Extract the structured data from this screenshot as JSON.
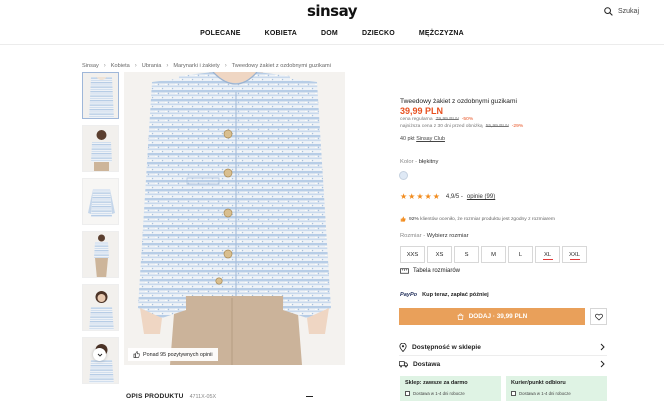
{
  "header": {
    "logo": "sinsay",
    "search_label": "Szukaj",
    "nav": [
      "POLECANE",
      "KOBIETA",
      "DOM",
      "DZIECKO",
      "MĘŻCZYZNA"
    ]
  },
  "breadcrumb": [
    "Sinsay",
    "Kobieta",
    "Ubrania",
    "Marynarki i żakiety",
    "Tweedowy żakiet z ozdobnymi guzikami"
  ],
  "gallery": {
    "reviews_pill": "Ponad 95 pozytywnych opinii"
  },
  "product": {
    "title": "Tweedowy żakiet z ozdobnymi guzikami",
    "price": "39,99 PLN",
    "regular_label": "cena regularna",
    "regular_price": "79,99 PLN",
    "regular_discount": "-50%",
    "lowest_label": "najniższa cena z 30 dni przed obniżką",
    "lowest_price": "55,99 PLN",
    "lowest_discount": "-29%",
    "points_text": "40 pkt",
    "points_link": "Sinsay Club",
    "color_label": "Kolor -",
    "color_value": "błękitny",
    "swatch_color": "#dfe9f5",
    "rating_value": "4,9/5 -",
    "rating_stars": 5,
    "rating_link": "opinie (99)",
    "fit_pct": "92%",
    "fit_text": "klientów oceniło, że rozmiar produktu jest zgodny z rozmiarem",
    "size_label": "Rozmiar -",
    "size_value": "Wybierz rozmiar",
    "sizes": [
      "XXS",
      "XS",
      "S",
      "M",
      "L",
      "XL",
      "XXL"
    ],
    "size_table": "Tabela rozmiarów",
    "paypo_logo": "PayPo",
    "paypo_text": "Kup teraz, zapłać później",
    "add_button": "DODAJ · 39,99 PLN"
  },
  "links": {
    "availability": "Dostępność w sklepie",
    "delivery": "Dostawa"
  },
  "delivery_options": [
    {
      "title": "Sklep: zawsze za darmo",
      "detail": "Dostawa w 1-4 dni robocze"
    },
    {
      "title": "Kurier/punkt odbioru",
      "detail": "Dostawa w 1-4 dni robocze"
    }
  ],
  "description": {
    "title": "OPIS PRODUKTU",
    "code": "4711X-05X"
  },
  "colors": {
    "accent": "#e8501f",
    "button": "#e9a05a",
    "star": "#f28c1e",
    "delivery_bg": "#dff3e4"
  }
}
